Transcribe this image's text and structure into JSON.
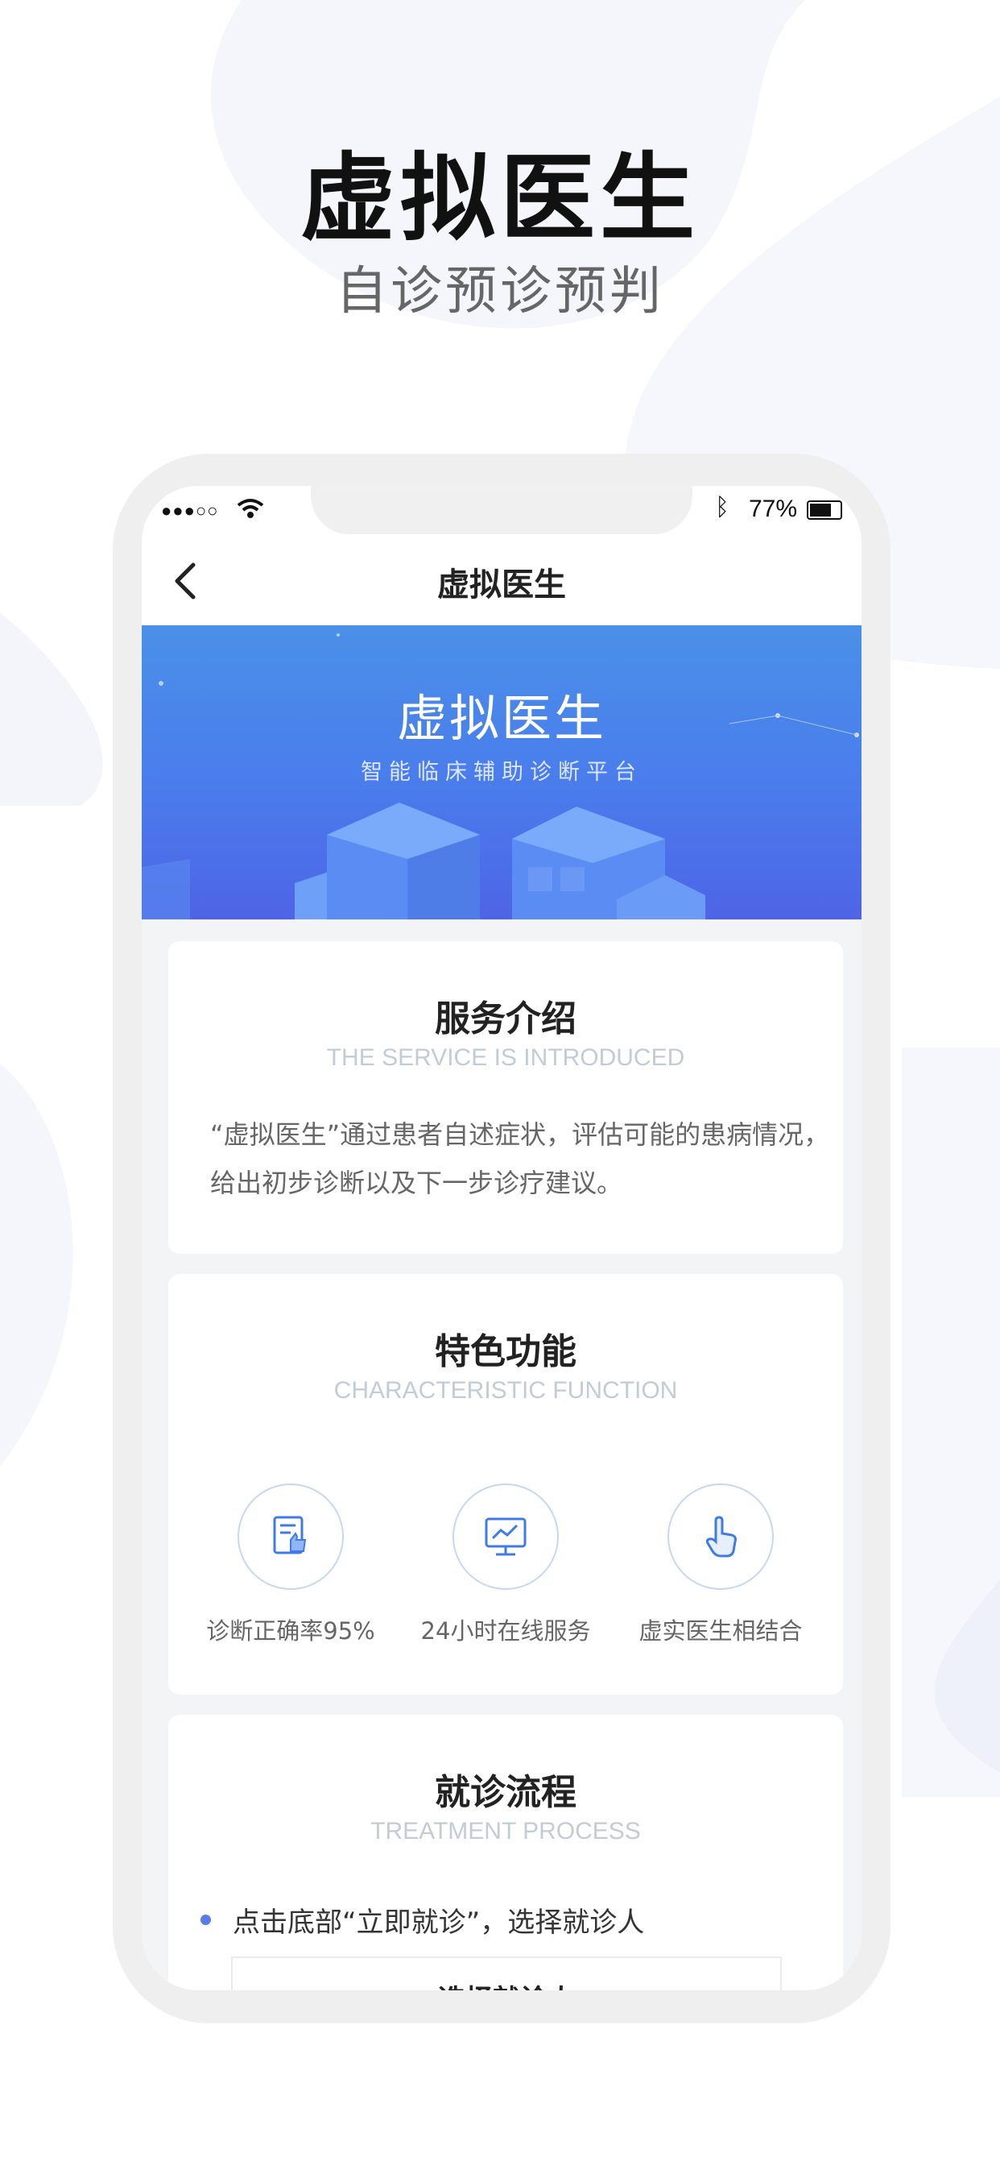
{
  "promo": {
    "title": "虚拟医生",
    "subtitle": "自诊预诊预判"
  },
  "status_bar": {
    "signal": "●●●○○",
    "battery_percent": "77%"
  },
  "nav": {
    "title": "虚拟医生"
  },
  "banner": {
    "title": "虚拟医生",
    "subtitle": "智能临床辅助诊断平台"
  },
  "service": {
    "title": "服务介绍",
    "subtitle_en": "THE SERVICE IS INTRODUCED",
    "text": "“虚拟医生”通过患者自述症状，评估可能的患病情况，给出初步诊断以及下一步诊疗建议。"
  },
  "features": {
    "title": "特色功能",
    "subtitle_en": "CHARACTERISTIC FUNCTION",
    "items": [
      {
        "label": "诊断正确率95%",
        "icon": "report-thumbs-up-icon"
      },
      {
        "label": "24小时在线服务",
        "icon": "monitor-chart-icon"
      },
      {
        "label": "虚实医生相结合",
        "icon": "hand-pointer-icon"
      }
    ]
  },
  "process": {
    "title": "就诊流程",
    "subtitle_en": "TREATMENT PROCESS",
    "step1": "点击底部“立即就诊”，选择就诊人",
    "preview_title": "选择就诊人"
  },
  "colors": {
    "accent": "#4a7cec",
    "dot": "#5b7be9"
  }
}
